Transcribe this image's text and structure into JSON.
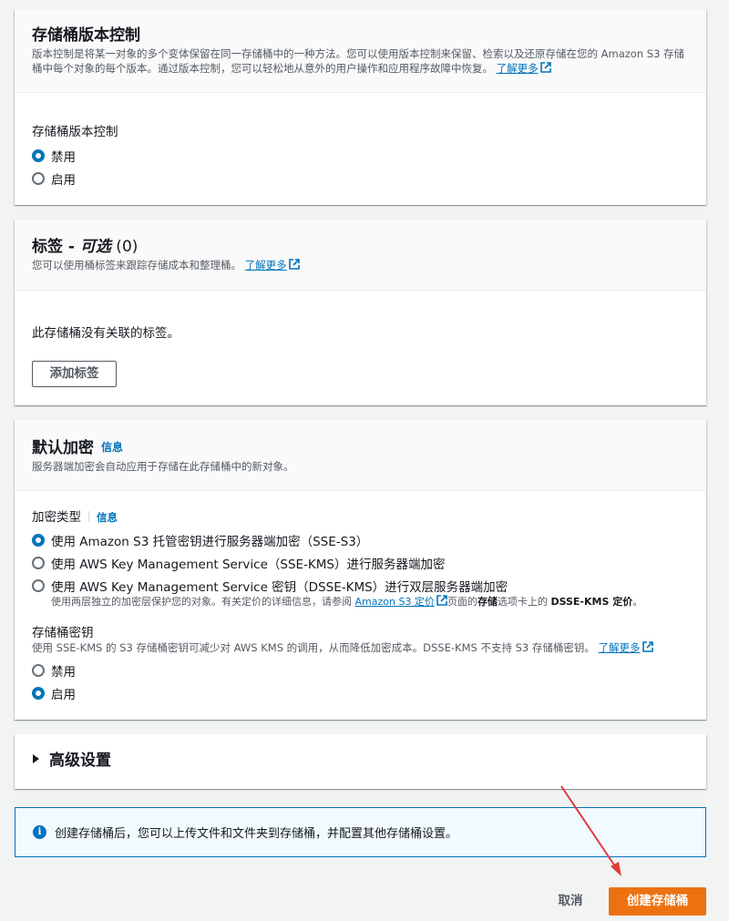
{
  "versioning": {
    "title": "存储桶版本控制",
    "desc": "版本控制是将某一对象的多个变体保留在同一存储桶中的一种方法。您可以使用版本控制来保留、检索以及还原存储在您的 Amazon S3 存储桶中每个对象的每个版本。通过版本控制，您可以轻松地从意外的用户操作和应用程序故障中恢复。",
    "learn_more": "了解更多",
    "field_label": "存储桶版本控制",
    "options": [
      "禁用",
      "启用"
    ],
    "selected": "禁用"
  },
  "tags": {
    "title": "标签 - ",
    "title_optional": "可选",
    "count": " (0)",
    "desc": "您可以使用桶标签来跟踪存储成本和整理桶。",
    "learn_more": "了解更多",
    "empty_text": "此存储桶没有关联的标签。",
    "add_button": "添加标签"
  },
  "encryption": {
    "title": "默认加密",
    "info": "信息",
    "desc": "服务器端加密会自动应用于存储在此存储桶中的新对象。",
    "type_label": "加密类型",
    "type_info": "信息",
    "options": [
      "使用 Amazon S3 托管密钥进行服务器端加密（SSE-S3）",
      "使用 AWS Key Management Service（SSE-KMS）进行服务器端加密",
      "使用 AWS Key Management Service 密钥（DSSE-KMS）进行双层服务器端加密"
    ],
    "selected": "使用 Amazon S3 托管密钥进行服务器端加密（SSE-S3）",
    "dsse_note_1": "使用两层独立的加密层保护您的对象。有关定价的详细信息，请参阅",
    "dsse_link": "Amazon S3 定价",
    "dsse_note_2": "页面的",
    "dsse_note_bold1": "存储",
    "dsse_note_3": "选项卡上的",
    "dsse_note_bold2": "DSSE-KMS 定价",
    "dsse_note_4": "。",
    "bucket_key_label": "存储桶密钥",
    "bucket_key_desc": "使用 SSE-KMS 的 S3 存储桶密钥可减少对 AWS KMS 的调用，从而降低加密成本。DSSE-KMS 不支持 S3 存储桶密钥。",
    "learn_more": "了解更多",
    "bucket_key_options": [
      "禁用",
      "启用"
    ],
    "bucket_key_selected": "启用"
  },
  "advanced": {
    "title": "高级设置"
  },
  "alert": {
    "text": "创建存储桶后，您可以上传文件和文件夹到存储桶，并配置其他存储桶设置。"
  },
  "footer": {
    "cancel": "取消",
    "create": "创建存储桶"
  },
  "colors": {
    "primary": "#ec7211",
    "link": "#0073bb",
    "annotation_arrow": "#e03c3c"
  }
}
